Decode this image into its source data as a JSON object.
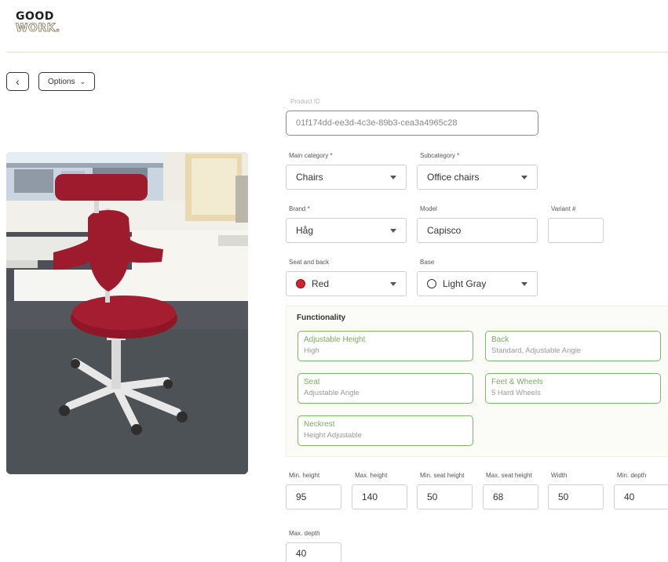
{
  "brand": {
    "line1": "GOOD",
    "line2": "WORK."
  },
  "nav": {
    "back_icon": "‹",
    "options_label": "Options",
    "options_icon": "⌄"
  },
  "product_id": {
    "label": "Product ID",
    "value": "01f174dd-ee3d-4c3e-89b3-cea3a4965c28"
  },
  "main_category": {
    "label": "Main category *",
    "value": "Chairs"
  },
  "subcategory": {
    "label": "Subcategory *",
    "value": "Office chairs"
  },
  "brand_field": {
    "label": "Brand *",
    "value": "Håg"
  },
  "model": {
    "label": "Model",
    "value": "Capisco"
  },
  "variant": {
    "label": "Variant #",
    "value": ""
  },
  "seat_and_back": {
    "label": "Seat and back",
    "value": "Red",
    "swatch_color": "#d2232e"
  },
  "base": {
    "label": "Base",
    "value": "Light Gray",
    "swatch_color": "#ffffff"
  },
  "functionality": {
    "title": "Functionality",
    "items": [
      {
        "title": "Adjustable Height",
        "value": "High"
      },
      {
        "title": "Back",
        "value": "Standard, Adjustable Angle"
      },
      {
        "title": "Seat",
        "value": "Adjustable Angle"
      },
      {
        "title": "Feet & Wheels",
        "value": "5 Hard Wheels"
      },
      {
        "title": "Neckrest",
        "value": "Height Adjustable"
      }
    ]
  },
  "dimensions": [
    {
      "label": "Min. height",
      "value": "95"
    },
    {
      "label": "Max. height",
      "value": "140"
    },
    {
      "label": "Min. seat height",
      "value": "50"
    },
    {
      "label": "Max. seat height",
      "value": "68"
    },
    {
      "label": "Width",
      "value": "50"
    },
    {
      "label": "Min. depth",
      "value": "40"
    },
    {
      "label": "Max. depth",
      "value": "40"
    }
  ],
  "colors": {
    "accent_green": "#7fb36a",
    "header_rule": "#d9e3c3"
  }
}
